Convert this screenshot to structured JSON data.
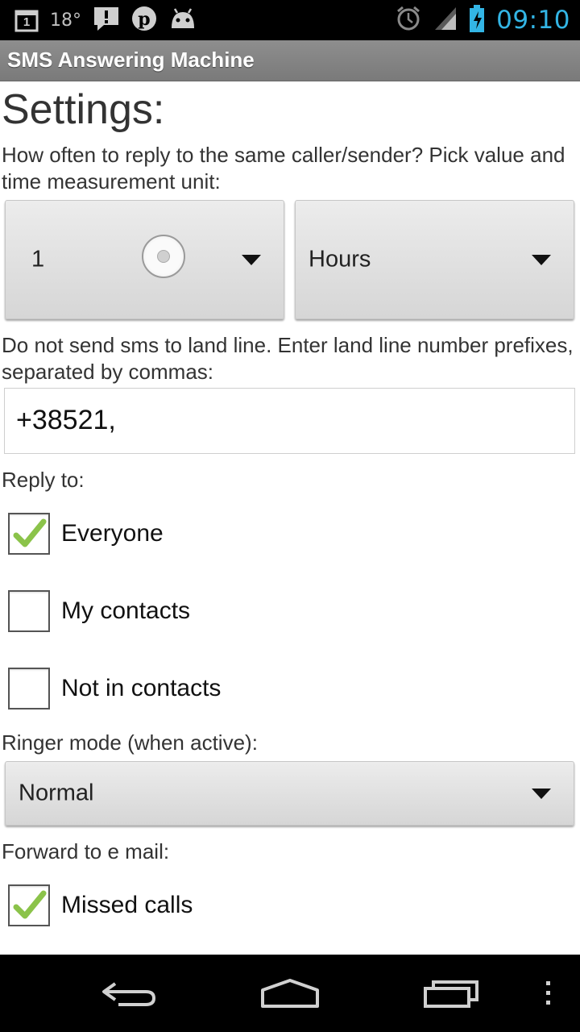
{
  "status_bar": {
    "calendar_day": "1",
    "temperature": "18°",
    "time": "09:10",
    "icons": [
      "calendar-icon",
      "weather-icon",
      "notification-alert-icon",
      "pinterest-icon",
      "android-icon",
      "alarm-icon",
      "signal-icon",
      "battery-charging-icon"
    ]
  },
  "title_bar": {
    "app_title": "SMS Answering Machine"
  },
  "settings": {
    "heading": "Settings:",
    "reply_frequency_label": "How often to reply to the same caller/sender? Pick value and time measurement unit:",
    "value_spinner": "1",
    "unit_spinner": "Hours",
    "landline_label": "Do not send sms to land line. Enter land line number prefixes, separated by commas:",
    "landline_prefixes": "+38521,",
    "reply_to_label": "Reply to:",
    "reply_to": [
      {
        "label": "Everyone",
        "checked": true
      },
      {
        "label": "My contacts",
        "checked": false
      },
      {
        "label": "Not in contacts",
        "checked": false
      }
    ],
    "ringer_label": "Ringer mode (when active):",
    "ringer_mode": "Normal",
    "forward_label": "Forward to e mail:",
    "forward_options": [
      {
        "label": "Missed calls",
        "checked": true
      }
    ]
  },
  "colors": {
    "accent_time": "#33b5e5",
    "check_green": "#8bc34a"
  }
}
